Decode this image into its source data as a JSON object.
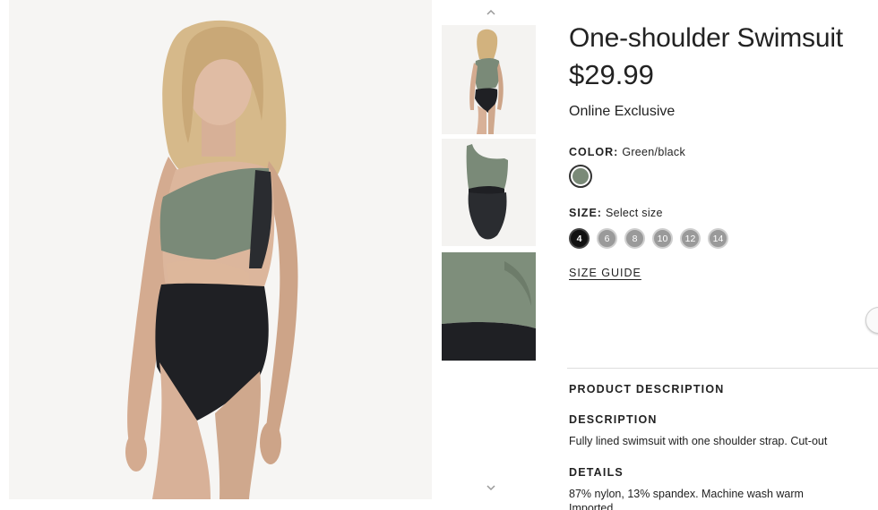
{
  "product": {
    "title": "One-shoulder Swimsuit",
    "price": "$29.99",
    "badge": "Online Exclusive"
  },
  "color": {
    "label": "COLOR:",
    "value": "Green/black",
    "swatch_hex": "#7a8a78"
  },
  "size": {
    "label": "SIZE:",
    "value": "Select size",
    "options": [
      "4",
      "6",
      "8",
      "10",
      "12",
      "14"
    ],
    "selected": "4"
  },
  "size_guide_label": "SIZE GUIDE",
  "product_description": {
    "heading": "PRODUCT DESCRIPTION",
    "description_heading": "DESCRIPTION",
    "description_text": "Fully lined swimsuit with one shoulder strap. Cut-out",
    "details_heading": "DETAILS",
    "details_text": "87% nylon, 13% spandex. Machine wash warm",
    "details_text_2": "Imported"
  },
  "gallery": {
    "up_icon": "chevron-up-icon",
    "down_icon": "chevron-down-icon",
    "thumbnails": [
      "model-front-thumbnail",
      "swimsuit-flat-thumbnail",
      "fabric-detail-thumbnail"
    ]
  },
  "colors": {
    "green": "#7a8a78",
    "black": "#1c1d20",
    "skin": "#d9b49a"
  }
}
